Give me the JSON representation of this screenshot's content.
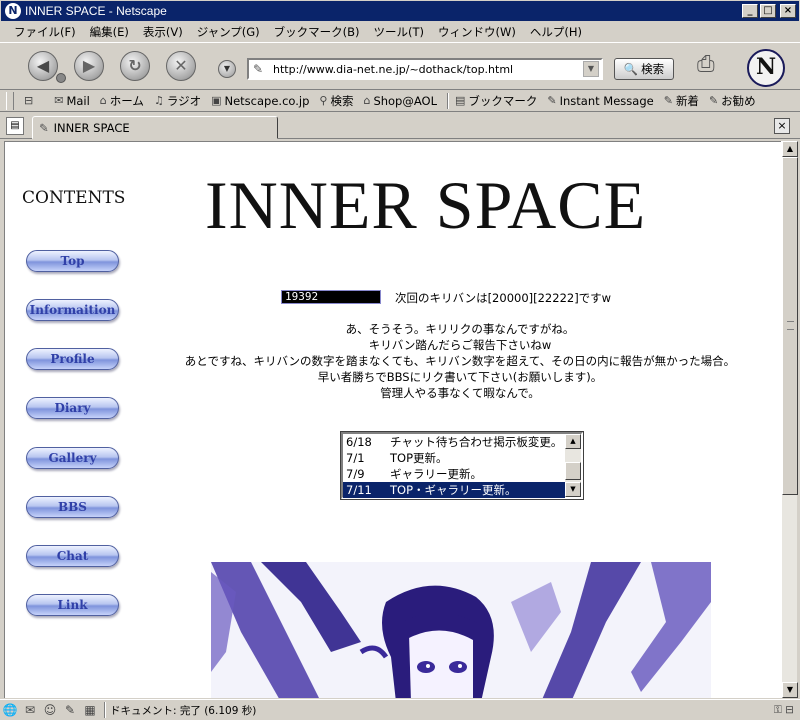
{
  "window": {
    "title": "INNER SPACE - Netscape"
  },
  "menu": [
    "ファイル(F)",
    "編集(E)",
    "表示(V)",
    "ジャンプ(G)",
    "ブックマーク(B)",
    "ツール(T)",
    "ウィンドウ(W)",
    "ヘルプ(H)"
  ],
  "toolbar": {
    "url": "http://www.dia-net.ne.jp/~dothack/top.html",
    "search_label": "検索"
  },
  "personal_toolbar": [
    "Mail",
    "ホーム",
    "ラジオ",
    "Netscape.co.jp",
    "検索",
    "Shop@AOL",
    "ブックマーク",
    "Instant Message",
    "新着",
    "お勧め"
  ],
  "tab": {
    "title": "INNER SPACE"
  },
  "page": {
    "contents_heading": "CONTENTS",
    "nav": [
      "Top",
      "Informaition",
      "Profile",
      "Diary",
      "Gallery",
      "BBS",
      "Chat",
      "Link"
    ],
    "site_title": "INNER SPACE",
    "counter": "19392",
    "kiriban_text": "次回のキリバンは[20000][22222]ですw",
    "notice_lines": [
      "あ、そうそう。キリリクの事なんですがね。",
      "キリバン踏んだらご報告下さいねw",
      "あとですね、キリバンの数字を踏まなくても、キリバン数字を超えて、その日の内に報告が無かった場合。",
      "早い者勝ちでBBSにリク書いて下さい(お願いします)。",
      "管理人やる事なくて暇なんで。"
    ],
    "updates": [
      {
        "date": "6/18",
        "text": "チャット待ち合わせ掲示板変更。"
      },
      {
        "date": "7/1",
        "text": "TOP更新。"
      },
      {
        "date": "7/9",
        "text": "ギャラリー更新。"
      },
      {
        "date": "7/11",
        "text": "TOP・ギャラリー更新。",
        "selected": true
      }
    ]
  },
  "status": {
    "text": "ドキュメント: 完了 (6.109 秒)"
  },
  "colors": {
    "titlebar": "#0a246a",
    "nav_button_text": "#3040a8",
    "selection": "#0a246a",
    "artwork": "#3a2a9a"
  }
}
